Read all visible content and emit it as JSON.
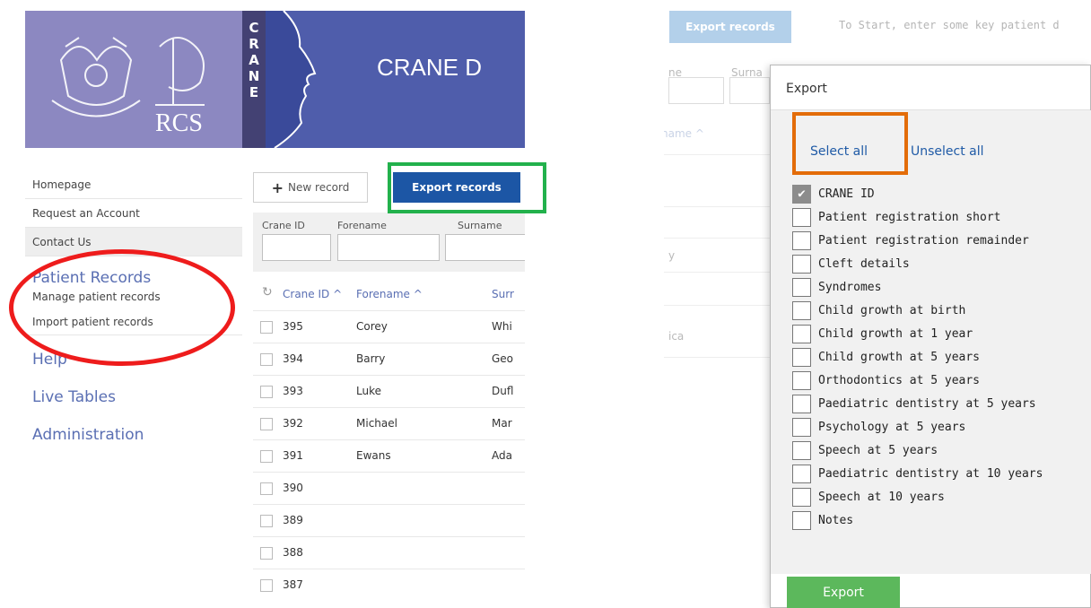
{
  "left": {
    "banner": {
      "crane_letters": [
        "C",
        "R",
        "A",
        "N",
        "E"
      ],
      "title": "CRANE D",
      "logo_text": "RCS"
    },
    "sidebar": {
      "top_links": [
        "Homepage",
        "Request an Account",
        "Contact Us"
      ],
      "section_title": "Patient Records",
      "section_items": [
        "Manage patient records",
        "Import patient records"
      ],
      "bottom_links": [
        "Help",
        "Live Tables",
        "Administration"
      ]
    },
    "toolbar": {
      "new_record": "New record",
      "export_records": "Export records"
    },
    "filters": [
      "Crane ID",
      "Forename",
      "Surname"
    ],
    "table": {
      "refresh_icon": "↻",
      "headers": [
        "Crane ID ^",
        "Forename ^",
        "Surr"
      ],
      "rows": [
        {
          "id": "395",
          "forename": "Corey",
          "surname": "Whi"
        },
        {
          "id": "394",
          "forename": "Barry",
          "surname": "Geo"
        },
        {
          "id": "393",
          "forename": "Luke",
          "surname": "Dufl"
        },
        {
          "id": "392",
          "forename": "Michael",
          "surname": "Mar"
        },
        {
          "id": "391",
          "forename": "Ewans",
          "surname": "Ada"
        },
        {
          "id": "390",
          "forename": "",
          "surname": ""
        },
        {
          "id": "389",
          "forename": "",
          "surname": ""
        },
        {
          "id": "388",
          "forename": "",
          "surname": ""
        },
        {
          "id": "387",
          "forename": "",
          "surname": ""
        }
      ]
    }
  },
  "right": {
    "export_records": "Export records",
    "hint": "To Start, enter some key patient d",
    "bg_labels": [
      "ne",
      "Surna",
      "name ^",
      "y",
      "ica"
    ],
    "modal": {
      "title": "Export",
      "select_all": "Select all",
      "unselect_all": "Unselect all",
      "options": [
        {
          "label": "CRANE ID",
          "checked": true
        },
        {
          "label": "Patient registration short",
          "checked": false
        },
        {
          "label": "Patient registration remainder",
          "checked": false
        },
        {
          "label": "Cleft details",
          "checked": false
        },
        {
          "label": "Syndromes",
          "checked": false
        },
        {
          "label": "Child growth at birth",
          "checked": false
        },
        {
          "label": "Child growth at 1 year",
          "checked": false
        },
        {
          "label": "Child growth at 5 years",
          "checked": false
        },
        {
          "label": "Orthodontics at 5 years",
          "checked": false
        },
        {
          "label": "Paediatric dentistry at 5 years",
          "checked": false
        },
        {
          "label": "Psychology at 5 years",
          "checked": false
        },
        {
          "label": "Speech at 5 years",
          "checked": false
        },
        {
          "label": "Paediatric dentistry at 10 years",
          "checked": false
        },
        {
          "label": "Speech at 10 years",
          "checked": false
        },
        {
          "label": "Notes",
          "checked": false
        }
      ],
      "export_button": "Export"
    }
  },
  "colors": {
    "banner_purple": "#8c88c1",
    "banner_blue": "#4f5dab",
    "export_blue": "#1c56a5",
    "highlight_red": "#ee1c1c",
    "highlight_green": "#22b14c",
    "highlight_orange": "#e36c09",
    "export_green": "#5cb85c"
  }
}
